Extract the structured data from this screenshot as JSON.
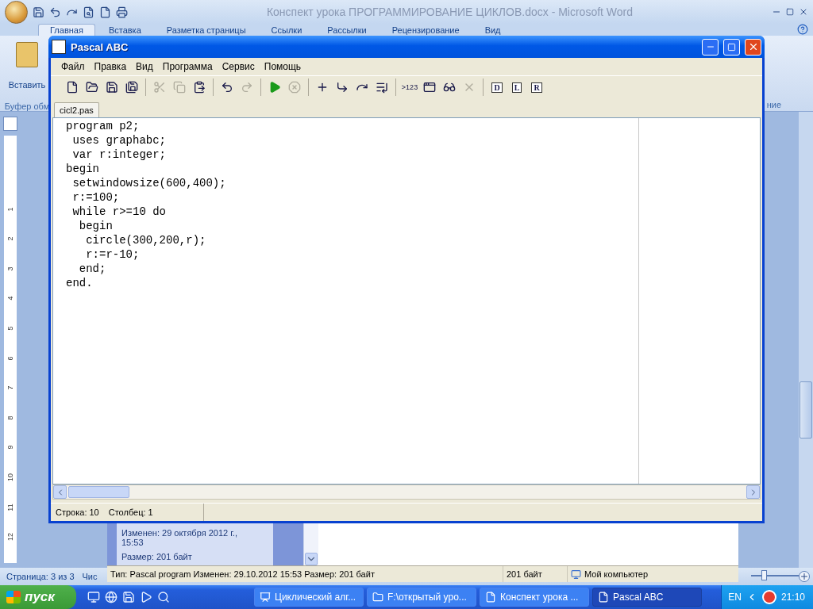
{
  "word": {
    "title": "Конспект урока ПРОГРАММИРОВАНИЕ ЦИКЛОВ.docx - Microsoft Word",
    "tabs": [
      {
        "label": "Главная",
        "selected": true
      },
      {
        "label": "Вставка",
        "selected": false
      },
      {
        "label": "Разметка страницы",
        "selected": false
      },
      {
        "label": "Ссылки",
        "selected": false
      },
      {
        "label": "Рассылки",
        "selected": false
      },
      {
        "label": "Рецензирование",
        "selected": false
      },
      {
        "label": "Вид",
        "selected": false
      }
    ],
    "ribbon": {
      "paste_label": "Вставить",
      "group_label": "Буфер обм",
      "right_group_label": "ние"
    },
    "ruler_marks": [
      "1",
      "2",
      "3",
      "4",
      "5",
      "6",
      "7",
      "8",
      "9",
      "10",
      "11",
      "12"
    ],
    "status": [
      "Страница: 3 из 3",
      "Чис"
    ],
    "zoom_slider": {
      "level": 0.25
    }
  },
  "explorer": {
    "details": [
      "Изменен: 29 октября 2012 г., 15:53",
      "Размер: 201 байт"
    ],
    "status": {
      "info": "Тип: Pascal program Изменен: 29.10.2012 15:53 Размер: 201 байт",
      "size": "201 байт",
      "zone": "Мой компьютер"
    }
  },
  "pascal": {
    "title": "Pascal ABC",
    "menu": [
      "Файл",
      "Правка",
      "Вид",
      "Программа",
      "Сервис",
      "Помощь"
    ],
    "toolbar": [
      [
        {
          "kind": "new",
          "disabled": false
        },
        {
          "kind": "open",
          "disabled": false
        },
        {
          "kind": "save",
          "disabled": false
        },
        {
          "kind": "save_all",
          "disabled": false
        }
      ],
      [
        {
          "kind": "cut",
          "disabled": true
        },
        {
          "kind": "copy",
          "disabled": true
        },
        {
          "kind": "paste",
          "disabled": false
        }
      ],
      [
        {
          "kind": "undo",
          "disabled": false
        },
        {
          "kind": "redo",
          "disabled": true
        }
      ],
      [
        {
          "kind": "run",
          "disabled": false
        },
        {
          "kind": "stop",
          "disabled": true
        }
      ],
      [
        {
          "kind": "watch",
          "disabled": false
        },
        {
          "kind": "step_into",
          "disabled": false
        },
        {
          "kind": "step_over",
          "disabled": false
        },
        {
          "kind": "run_to_cursor",
          "disabled": false
        }
      ],
      [
        {
          "kind": "text",
          "label": ">123",
          "disabled": false
        },
        {
          "kind": "window",
          "disabled": false
        },
        {
          "kind": "glasses",
          "disabled": false
        },
        {
          "kind": "delete",
          "disabled": true
        }
      ],
      [
        {
          "kind": "doc",
          "label": "D",
          "disabled": false
        },
        {
          "kind": "doc",
          "label": "L",
          "disabled": false
        },
        {
          "kind": "doc",
          "label": "R",
          "disabled": false
        }
      ]
    ],
    "tabs": [
      {
        "label": "cicl2.pas",
        "selected": true
      }
    ],
    "code": [
      "program p2;",
      " uses graphabc;",
      " var r:integer;",
      "begin",
      " setwindowsize(600,400);",
      " r:=100;",
      " while r>=10 do",
      "  begin",
      "   circle(300,200,r);",
      "   r:=r-10;",
      "  end;",
      "end."
    ],
    "status": [
      "Строка: 10",
      "Столбец: 1"
    ]
  },
  "taskbar": {
    "start": "пуск",
    "tasks": [
      {
        "kind": "presentation",
        "label": "Циклический алг...",
        "selected": false
      },
      {
        "kind": "folder",
        "label": "F:\\открытый уро...",
        "selected": false
      },
      {
        "kind": "word",
        "label": "Конспект урока ...",
        "selected": false
      },
      {
        "kind": "pascal",
        "label": "Pascal ABC",
        "selected": true
      }
    ],
    "language": "EN",
    "clock": "21:10"
  }
}
